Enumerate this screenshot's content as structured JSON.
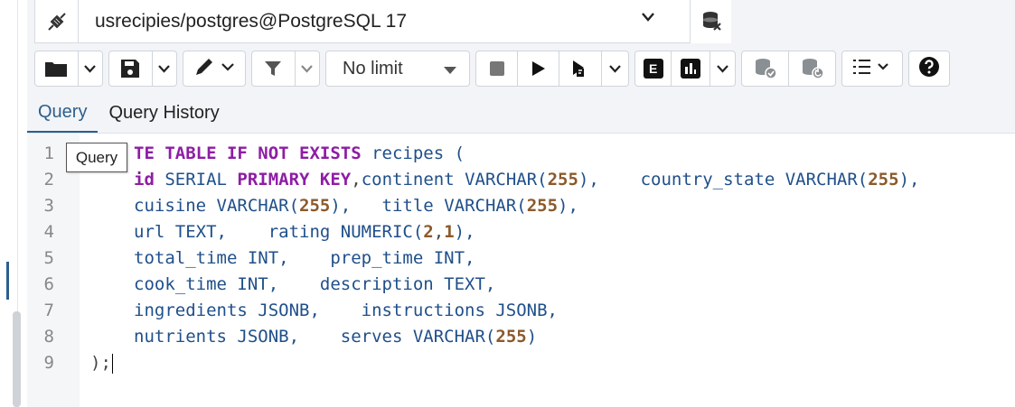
{
  "connection": {
    "label": "usrecipies/postgres@PostgreSQL 17",
    "icon": "connection-plug-icon",
    "db_icon": "database-icon"
  },
  "toolbar": {
    "limit_label": "No limit",
    "explain_label": "E"
  },
  "tabs": [
    {
      "label": "Query",
      "active": true
    },
    {
      "label": "Query History",
      "active": false
    }
  ],
  "tooltip": "Query",
  "editor": {
    "line_numbers": [
      "1",
      "2",
      "3",
      "4",
      "5",
      "6",
      "7",
      "8",
      "9"
    ],
    "lines": [
      [
        {
          "t": "kw",
          "v": "TE TABLE IF NOT EXISTS"
        },
        {
          "t": "id",
          "v": " recipes ("
        }
      ],
      [
        {
          "t": "kw",
          "v": "id"
        },
        {
          "t": "id",
          "v": " SERIAL "
        },
        {
          "t": "kw",
          "v": "PRIMARY KEY"
        },
        {
          "t": "pn",
          "v": ","
        },
        {
          "t": "id",
          "v": "continent VARCHAR("
        },
        {
          "t": "num",
          "v": "255"
        },
        {
          "t": "id",
          "v": "),    country_state VARCHAR("
        },
        {
          "t": "num",
          "v": "255"
        },
        {
          "t": "id",
          "v": "),"
        }
      ],
      [
        {
          "t": "id",
          "v": "cuisine VARCHAR("
        },
        {
          "t": "num",
          "v": "255"
        },
        {
          "t": "id",
          "v": "),   title VARCHAR("
        },
        {
          "t": "num",
          "v": "255"
        },
        {
          "t": "id",
          "v": "),"
        }
      ],
      [
        {
          "t": "id",
          "v": "url TEXT,    rating NUMERIC("
        },
        {
          "t": "num",
          "v": "2"
        },
        {
          "t": "pn",
          "v": ","
        },
        {
          "t": "num",
          "v": "1"
        },
        {
          "t": "id",
          "v": "),"
        }
      ],
      [
        {
          "t": "id",
          "v": "total_time INT,    prep_time INT,"
        }
      ],
      [
        {
          "t": "id",
          "v": "cook_time INT,    description TEXT,"
        }
      ],
      [
        {
          "t": "id",
          "v": "ingredients JSONB,    instructions JSONB,"
        }
      ],
      [
        {
          "t": "id",
          "v": "nutrients JSONB,    serves VARCHAR("
        },
        {
          "t": "num",
          "v": "255"
        },
        {
          "t": "id",
          "v": ")"
        }
      ],
      [
        {
          "t": "pn",
          "v": ");"
        }
      ]
    ]
  }
}
